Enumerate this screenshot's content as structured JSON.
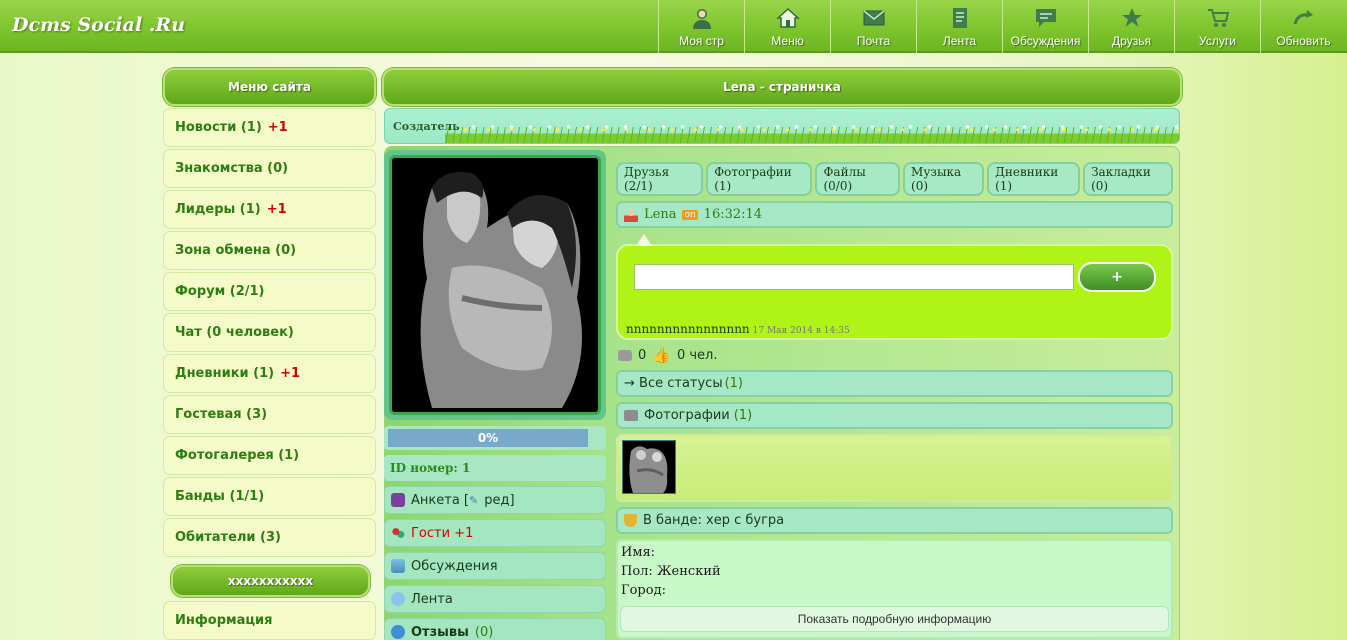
{
  "site": {
    "logo": "Dcms Social .Ru"
  },
  "nav": [
    {
      "label": "Моя стр",
      "icon": "user-icon"
    },
    {
      "label": "Меню",
      "icon": "home-icon"
    },
    {
      "label": "Почта",
      "icon": "mail-icon"
    },
    {
      "label": "Лента",
      "icon": "feed-icon"
    },
    {
      "label": "Обсуждения",
      "icon": "chat-icon"
    },
    {
      "label": "Друзья",
      "icon": "star-icon"
    },
    {
      "label": "Услуги",
      "icon": "cart-icon"
    },
    {
      "label": "Обновить",
      "icon": "refresh-icon"
    }
  ],
  "sidebar": {
    "title": "Меню сайта",
    "items": [
      {
        "label": "Новости (1)",
        "badge": "+1"
      },
      {
        "label": "Знакомства (0)",
        "badge": ""
      },
      {
        "label": "Лидеры (1)",
        "badge": "+1"
      },
      {
        "label": "Зона обмена (0)",
        "badge": ""
      },
      {
        "label": "Форум (2/1)",
        "badge": ""
      },
      {
        "label": "Чат (0 человек)",
        "badge": ""
      },
      {
        "label": "Дневники (1)",
        "badge": "+1"
      },
      {
        "label": "Гостевая (3)",
        "badge": ""
      },
      {
        "label": "Фотогалерея (1)",
        "badge": ""
      },
      {
        "label": "Банды (1/1)",
        "badge": ""
      },
      {
        "label": "Обитатели (3)",
        "badge": ""
      }
    ],
    "second_title": "xxxxxxxxxxx",
    "info_label": "Информация"
  },
  "page": {
    "title": "Lena - страничка",
    "creator_label": "Создатель"
  },
  "profile": {
    "progress": "0%",
    "id_label": "ID номер: 1",
    "links": [
      {
        "pre": "Анкета [",
        "edit": "ред]",
        "icon": "profile-icon"
      },
      {
        "label": "Гости +1",
        "icon": "guests-icon"
      },
      {
        "label": "Обсуждения",
        "icon": "discussions-icon"
      },
      {
        "label": "Лента",
        "icon": "feed-cloud-icon"
      },
      {
        "label": "Отзывы",
        "count": "(0)",
        "icon": "reviews-icon"
      }
    ]
  },
  "tabs": [
    "Друзья (2/1)",
    "Фотографии (1)",
    "Файлы (0/0)",
    "Музыка (0)",
    "Дневники (1)",
    "Закладки (0)"
  ],
  "user_row": {
    "name": "Lena",
    "online": "on",
    "time": "16:32:14"
  },
  "status": {
    "button": "+",
    "text": "nnnnnnnnnnnnnnnn",
    "date": "17 Мая 2014 в 14:35",
    "comments": "0",
    "likes": "0 чел."
  },
  "rows": {
    "all_statuses": "→ Все статусы",
    "all_statuses_count": "(1)",
    "photos": "Фотографии",
    "photos_count": "(1)",
    "gang": "В банде: хер с бугра"
  },
  "info": {
    "name_label": "Имя:",
    "gender_label": "Пол:",
    "gender_value": "Женский",
    "city_label": "Город:",
    "more_button": "Показать подробную информацию"
  }
}
